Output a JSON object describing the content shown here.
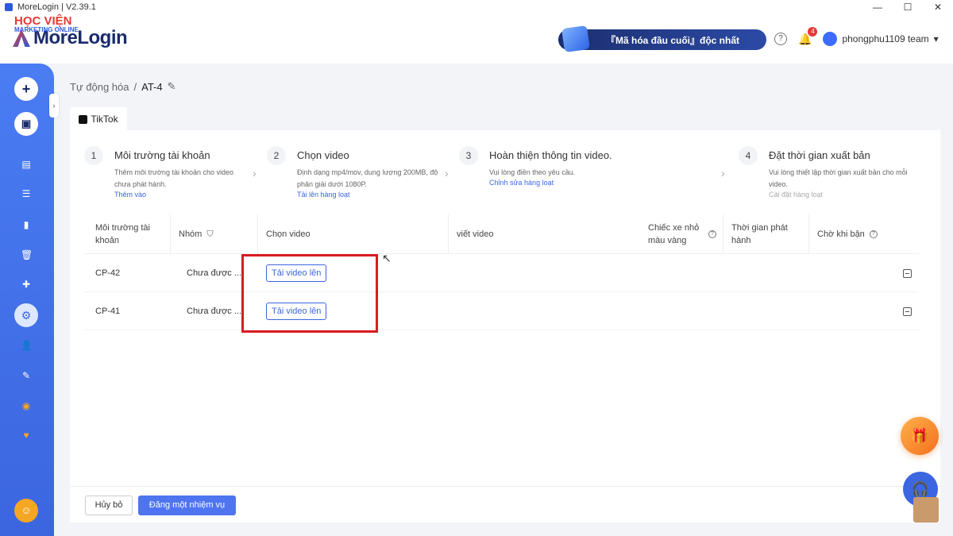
{
  "window": {
    "title": "MoreLogin | V2.39.1",
    "minimize": "—",
    "maximize": "☐",
    "close": "✕"
  },
  "logo": {
    "name": "MoreLogin",
    "watermark_title": "HỌC VIỆN",
    "watermark_sub": "MARKETING ONLINE"
  },
  "header": {
    "promo_text": "『Mã hóa đầu cuối』độc nhất",
    "help_icon": "?",
    "notification_count": "4",
    "user_name": "phongphu1109 team",
    "user_caret": "▾"
  },
  "sidebar": {
    "new_button": "+",
    "collapse": "›",
    "icons": [
      "browser-icon",
      "list-icon",
      "clipboard-icon",
      "trash-icon",
      "puzzle-icon",
      "robot-icon",
      "users-icon",
      "api-icon",
      "clock-icon",
      "heart-icon",
      "support-icon"
    ]
  },
  "breadcrumb": {
    "root": "Tự động hóa",
    "sep": "/",
    "current": "AT-4",
    "edit": "✎"
  },
  "tab": {
    "label": "TikTok"
  },
  "steps": [
    {
      "num": "1",
      "title": "Môi trường tài khoản",
      "desc": "Thêm môi trường tài khoản cho video chưa phát hành.",
      "link": "Thêm vào"
    },
    {
      "num": "2",
      "title": "Chọn video",
      "desc": "Định dạng mp4/mov, dung lượng 200MB, độ phân giải dưới 1080P.",
      "link": "Tải lên hàng loạt"
    },
    {
      "num": "3",
      "title": "Hoàn thiện thông tin video.",
      "desc": "Vui lòng điền theo yêu cầu.",
      "link": "Chỉnh sửa hàng loạt"
    },
    {
      "num": "4",
      "title": "Đặt thời gian xuất bản",
      "desc": "Vui lòng thiết lập thời gian xuất bản cho mỗi video.",
      "link": "Cài đặt hàng loạt"
    }
  ],
  "table": {
    "headers": {
      "env": "Môi trường tài khoản",
      "group": "Nhóm",
      "video": "Chọn video",
      "write": "viết video",
      "cart": "Chiếc xe nhỏ màu vàng",
      "time": "Thời gian phát hành",
      "wait": "Chờ khi bận"
    },
    "rows": [
      {
        "env": "CP-42",
        "group": "Chưa được ...",
        "upload": "Tải video lên"
      },
      {
        "env": "CP-41",
        "group": "Chưa được ...",
        "upload": "Tải video lên"
      }
    ]
  },
  "footer": {
    "cancel": "Hủy bỏ",
    "submit": "Đăng một nhiệm vụ"
  },
  "colors": {
    "accent": "#3b66e0",
    "highlight": "#d91c22",
    "sidebar": "#4a7cf3"
  }
}
